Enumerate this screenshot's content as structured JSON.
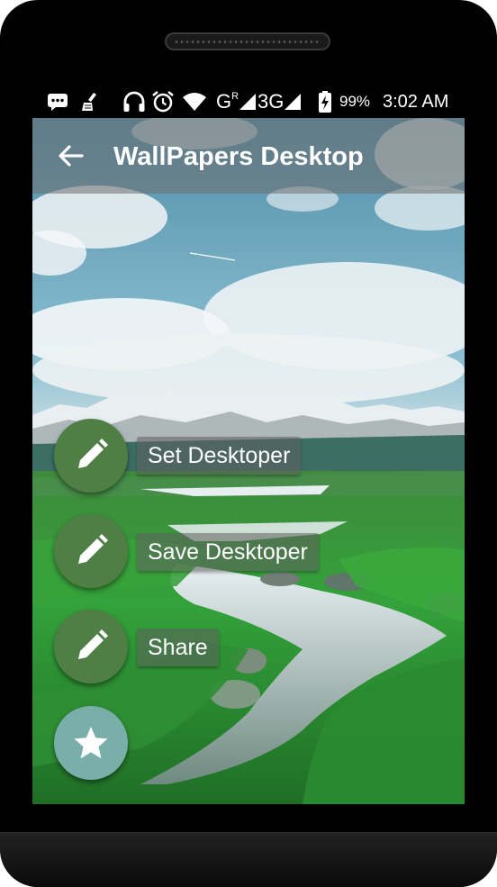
{
  "statusbar": {
    "icons": [
      "message-icon",
      "cleaner-icon",
      "headphones-icon",
      "alarm-icon",
      "wifi-icon",
      "signal-g-r-icon",
      "signal-3g-icon",
      "battery-charging-icon"
    ],
    "sim_label": "G",
    "roaming_label": "R",
    "network_label": "3G",
    "battery": "99%",
    "time": "3:02 AM"
  },
  "appbar": {
    "title": "WallPapers Desktop",
    "back_icon": "arrow-left-icon"
  },
  "actions": [
    {
      "label": "Set Desktoper",
      "icon": "pencil-icon"
    },
    {
      "label": "Save Desktoper",
      "icon": "pencil-icon"
    },
    {
      "label": "Share",
      "icon": "pencil-icon"
    }
  ],
  "main_fab": {
    "icon": "star-icon"
  },
  "colors": {
    "fab_green": "#4f7f45",
    "fab_teal": "#79aea9",
    "appbar_overlay": "rgba(110,110,110,0.55)"
  }
}
